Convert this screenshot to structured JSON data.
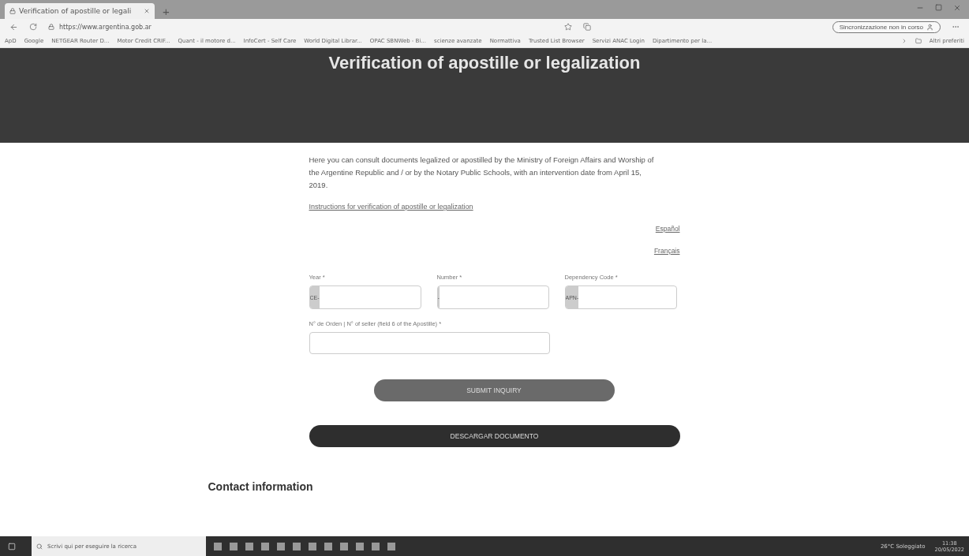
{
  "browser": {
    "tab_title": "Verification of apostille or legali",
    "new_tab": "+",
    "address": "https://www.argentina.gob.ar",
    "sync_label": "Sincronizzazione non in corso",
    "bookmarks": [
      "ApD",
      "Google",
      "NETGEAR Router D...",
      "Motor Credit CRIF...",
      "Quant - il motore d...",
      "InfoCert - Self Care",
      "World Digital Librar...",
      "OPAC SBNWeb - Bi...",
      "scienze avanzate",
      "Normattiva",
      "Trusted List Browser",
      "Servizi ANAC Login",
      "Dipartimento per la..."
    ],
    "other_bookmarks": "Altri preferiti"
  },
  "page": {
    "title": "Verification of apostille or legalization",
    "intro": "Here you can consult documents legalized or apostilled by the Ministry of Foreign Affairs and Worship of the Argentine Republic and / or by the Notary Public Schools, with an intervention date from April 15, 2019.",
    "instructions_link": "Instructions for verification of apostille or legalization",
    "languages": [
      "Español",
      "Français"
    ],
    "fields": [
      {
        "label": "Year *",
        "prefix": "CE-"
      },
      {
        "label": "Number *",
        "prefix": "-"
      },
      {
        "label": "Dependency Code *",
        "prefix": "APN-"
      }
    ],
    "order_field": {
      "label": "N° de Orden | N° of seller (field 6 of the Apostille) *"
    },
    "submit": "SUBMIT INQUIRY",
    "download": "DESCARGAR DOCUMENTO",
    "contact_heading": "Contact information"
  },
  "taskbar": {
    "search_placeholder": "Scrivi qui per eseguire la ricerca",
    "weather": "26°C Soleggiato",
    "time": "11:38",
    "date": "20/05/2022"
  }
}
